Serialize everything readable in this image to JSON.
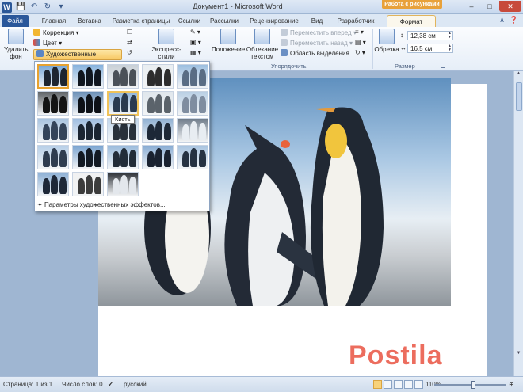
{
  "window": {
    "title": "Документ1 - Microsoft Word",
    "contextual_header": "Работа с рисунками",
    "qat_icons": [
      "word-logo",
      "save-icon",
      "undo-icon",
      "redo-icon",
      "customize-icon"
    ],
    "word_logo_letter": "W"
  },
  "tabs": [
    {
      "label": "Файл"
    },
    {
      "label": "Главная"
    },
    {
      "label": "Вставка"
    },
    {
      "label": "Разметка страницы"
    },
    {
      "label": "Ссылки"
    },
    {
      "label": "Рассылки"
    },
    {
      "label": "Рецензирование"
    },
    {
      "label": "Вид"
    },
    {
      "label": "Разработчик"
    },
    {
      "label": "Формат"
    }
  ],
  "ribbon": {
    "remove_bg": "Удалить фон",
    "correction": "Коррекция",
    "color": "Цвет",
    "art_effects": "Художественные эффекты",
    "express_styles": "Экспресс-стили",
    "position": "Положение",
    "wrap_text": "Обтекание текстом",
    "bring_forward": "Переместить вперед",
    "send_backward": "Переместить назад",
    "selection_pane": "Область выделения",
    "arrange_group": "Упорядочить",
    "crop": "Обрезка",
    "height_value": "12,38 см",
    "width_value": "16,5 см",
    "size_group": "Размер"
  },
  "gallery": {
    "footer": "Параметры художественных эффектов...",
    "tooltip": "Кисть",
    "selected_index": 0,
    "hover_index": 7,
    "thumbnails": [
      {
        "bg": "#7aa9d8",
        "fg": "#1e2530"
      },
      {
        "bg": "#86b2dd",
        "fg": "#10161f"
      },
      {
        "bg": "#c9d0d6",
        "fg": "#4b5158"
      },
      {
        "bg": "#e9eef1",
        "fg": "#2d2d2d"
      },
      {
        "bg": "#9dbfe0",
        "fg": "#5a6d84"
      },
      {
        "bg": "#5e6266",
        "fg": "#141414"
      },
      {
        "bg": "#6a8fb6",
        "fg": "#0d1117"
      },
      {
        "bg": "#8fb4da",
        "fg": "#2a3a4f"
      },
      {
        "bg": "#dfe6ec",
        "fg": "#5b636b"
      },
      {
        "bg": "#b9cfe4",
        "fg": "#7f8da0"
      },
      {
        "bg": "#a8c3df",
        "fg": "#34445a"
      },
      {
        "bg": "#9fbde0",
        "fg": "#1b2532"
      },
      {
        "bg": "#c3d7ec",
        "fg": "#29313b"
      },
      {
        "bg": "#8fb0d2",
        "fg": "#1d2837"
      },
      {
        "bg": "#6f7c8a",
        "fg": "#e8edf2"
      },
      {
        "bg": "#b7cfe8",
        "fg": "#2f3d50"
      },
      {
        "bg": "#7aa4d0",
        "fg": "#131a24"
      },
      {
        "bg": "#9bbbdc",
        "fg": "#222c38"
      },
      {
        "bg": "#88acd3",
        "fg": "#1a2230"
      },
      {
        "bg": "#a9c4e0",
        "fg": "#263242"
      },
      {
        "bg": "#8db0d5",
        "fg": "#1e2838"
      },
      {
        "bg": "#f1f1f1",
        "fg": "#3c3c3c"
      },
      {
        "bg": "#2b2f35",
        "fg": "#e3e7ec"
      }
    ]
  },
  "statusbar": {
    "page": "Страница: 1 из 1",
    "words": "Число слов: 0",
    "language": "русский",
    "zoom": "110%"
  },
  "watermark": "Postila"
}
